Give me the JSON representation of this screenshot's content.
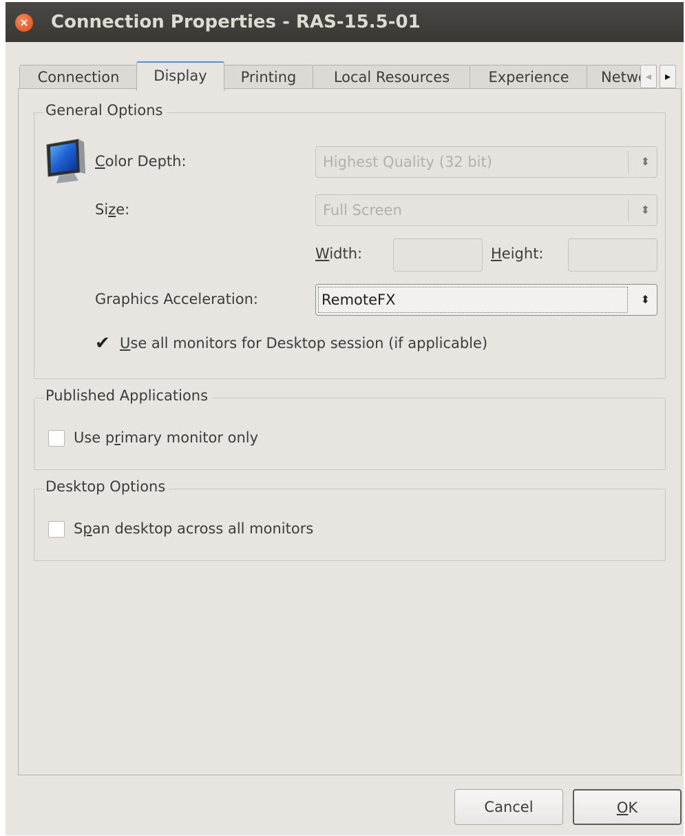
{
  "window": {
    "title": "Connection Properties - RAS-15.5-01",
    "close_symbol": "×"
  },
  "tabs": [
    "Connection",
    "Display",
    "Printing",
    "Local Resources",
    "Experience",
    "Network"
  ],
  "active_tab": "Display",
  "tab_scroll": {
    "left": "◂",
    "right": "▸"
  },
  "general": {
    "legend": "General Options",
    "monitor_icon": "monitor-icon",
    "color_depth": {
      "label_pre": "",
      "label_u": "C",
      "label_post": "olor Depth:",
      "value": "Highest Quality (32 bit)",
      "enabled": false
    },
    "size": {
      "label_pre": "Si",
      "label_u": "z",
      "label_post": "e:",
      "value": "Full Screen",
      "enabled": false
    },
    "width": {
      "label_pre": "",
      "label_u": "W",
      "label_post": "idth:",
      "value": ""
    },
    "height": {
      "label_pre": "",
      "label_u": "H",
      "label_post": "eight:",
      "value": ""
    },
    "graphics": {
      "label": "Graphics Acceleration:",
      "value": "RemoteFX",
      "enabled": true
    },
    "use_all_monitors": {
      "label_pre": "",
      "label_u": "U",
      "label_post": "se all monitors for Desktop session (if applicable)",
      "checked": true
    }
  },
  "published": {
    "legend": "Published Applications",
    "primary_only": {
      "label_pre": "Use p",
      "label_u": "r",
      "label_post": "imary monitor only",
      "checked": false
    }
  },
  "desktop": {
    "legend": "Desktop Options",
    "span": {
      "label_pre": "S",
      "label_u": "p",
      "label_post": "an desktop across all monitors",
      "checked": false
    }
  },
  "buttons": {
    "cancel": "Cancel",
    "ok": {
      "label_pre": "",
      "label_u": "O",
      "label_post": "K"
    }
  },
  "combo_arrows": "⬍",
  "check_mark": "✔",
  "colors": {
    "titlebar": "#3f3d3a",
    "close": "#e8531f",
    "active_tab_accent": "#5b8fc7",
    "dialog_bg": "#e8e5e1"
  }
}
